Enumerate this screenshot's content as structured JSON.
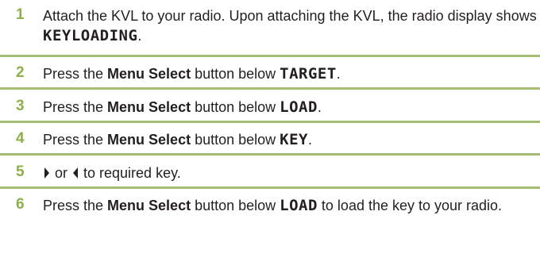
{
  "steps": [
    {
      "number": "1",
      "text_a": "Attach the KVL to your radio. Upon attaching the KVL, the radio display shows ",
      "display": "KEYLOADING",
      "text_b": "."
    },
    {
      "number": "2",
      "text_a": "Press the ",
      "bold": "Menu Select",
      "text_b": " button below ",
      "display": "TARGET",
      "text_c": "."
    },
    {
      "number": "3",
      "text_a": "Press the ",
      "bold": "Menu Select",
      "text_b": " button below ",
      "display": "LOAD",
      "text_c": "."
    },
    {
      "number": "4",
      "text_a": "Press the ",
      "bold": "Menu Select",
      "text_b": " button below ",
      "display": "KEY",
      "text_c": "."
    },
    {
      "number": "5",
      "icon_right": "right-arrow-icon",
      "text_or": " or ",
      "icon_left": "left-arrow-icon",
      "text_a": " to required key."
    },
    {
      "number": "6",
      "text_a": "Press the ",
      "bold": "Menu Select",
      "text_b": " button below ",
      "display": "LOAD",
      "text_c": " to load the key to your radio."
    }
  ],
  "colors": {
    "number": "#8eb04a",
    "divider": "#a6bd74",
    "text": "#231f20"
  }
}
